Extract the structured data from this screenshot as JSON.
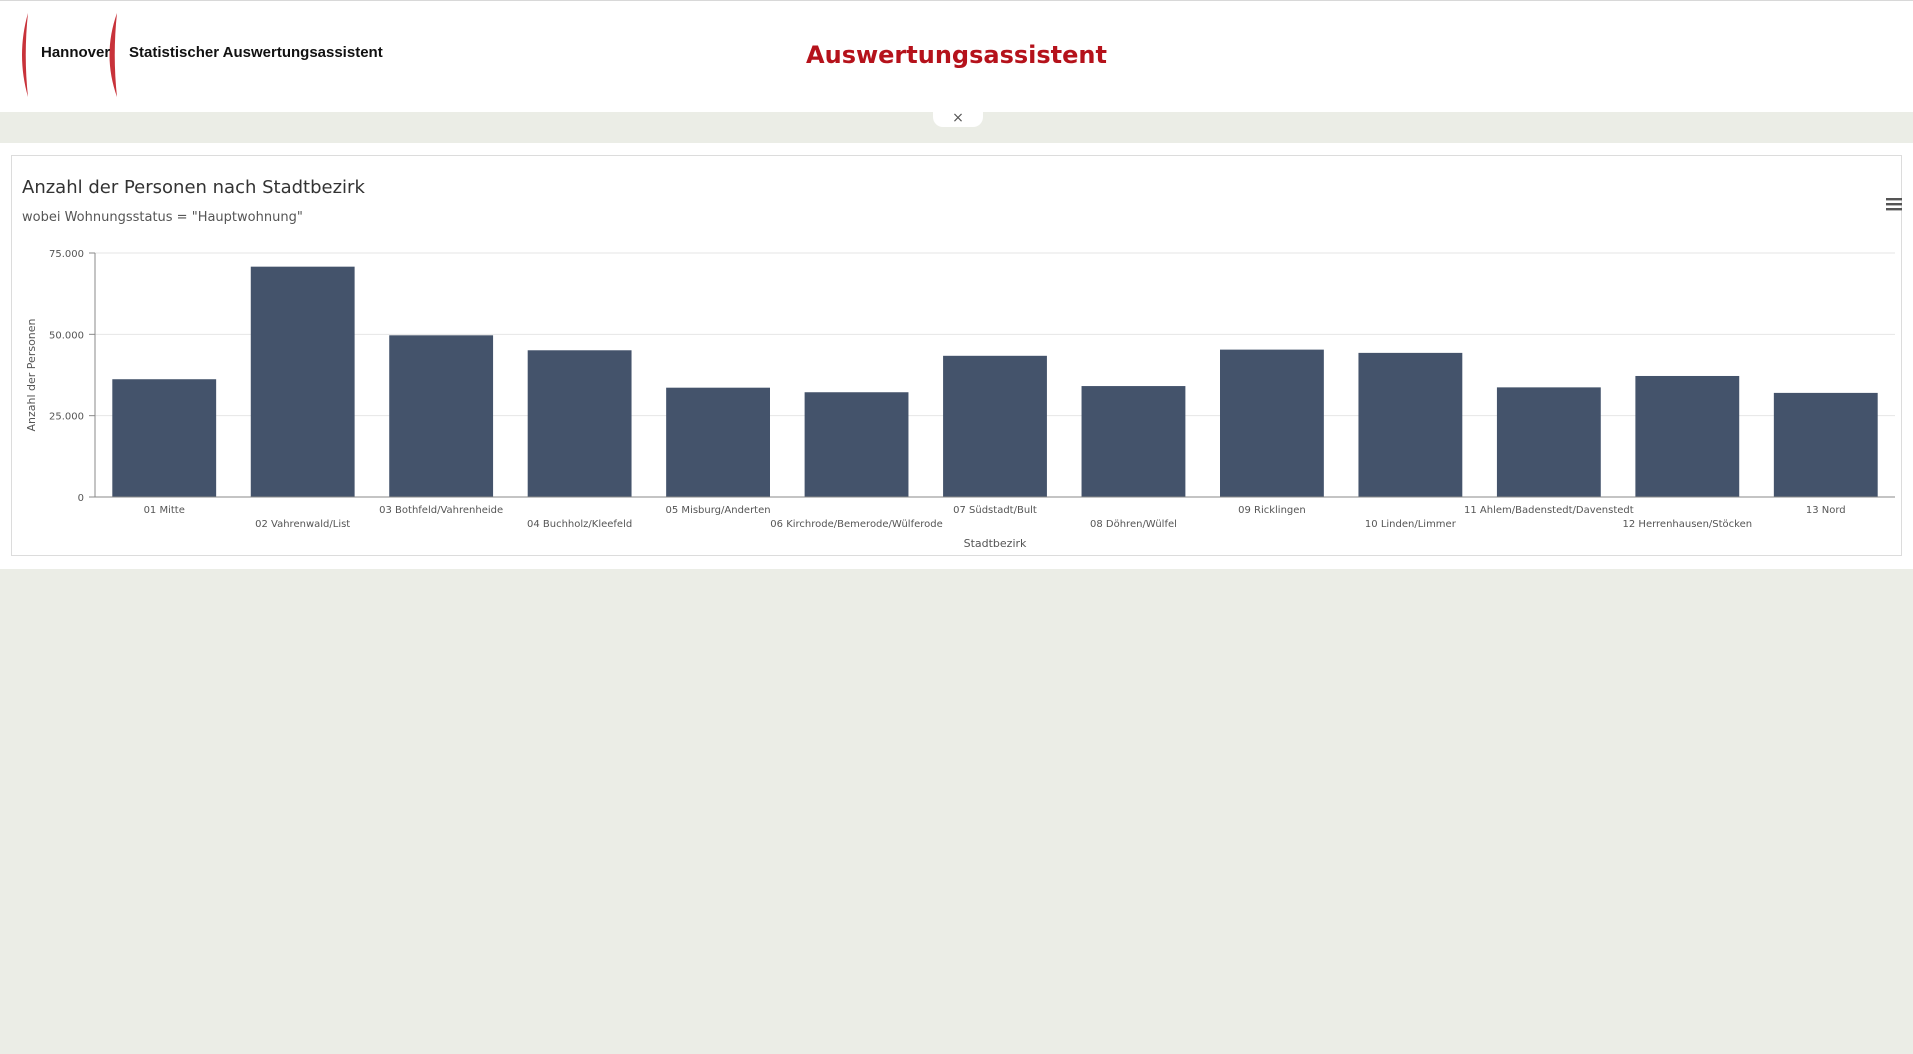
{
  "header": {
    "logo_city": "Hannover",
    "logo_app": "Statistischer Auswertungsassistent",
    "title": "Auswertungsassistent",
    "close_glyph": "×"
  },
  "colors": {
    "accent": "#b5121b",
    "bar": "#44536b",
    "background": "#ebede6"
  },
  "icons": {
    "menu": "hamburger-menu-icon",
    "close": "close-icon"
  },
  "chart_data": {
    "type": "bar",
    "title": "Anzahl der Personen nach Stadtbezirk",
    "subtitle": "wobei Wohnungsstatus = \"Hauptwohnung\"",
    "xlabel": "Stadtbezirk",
    "ylabel": "Anzahl der Personen",
    "ylim": [
      0,
      75000
    ],
    "yticks": [
      0,
      25000,
      50000,
      75000
    ],
    "ytick_labels": [
      "0",
      "25.000",
      "50.000",
      "75.000"
    ],
    "grid": true,
    "legend": "none",
    "categories": [
      "01 Mitte",
      "02 Vahrenwald/List",
      "03 Bothfeld/Vahrenheide",
      "04 Buchholz/Kleefeld",
      "05 Misburg/Anderten",
      "06 Kirchrode/Bemerode/Wülferode",
      "07 Südstadt/Bult",
      "08 Döhren/Wülfel",
      "09 Ricklingen",
      "10 Linden/Limmer",
      "11 Ahlem/Badenstedt/Davenstedt",
      "12 Herrenhausen/Stöcken",
      "13 Nord"
    ],
    "values": [
      36200,
      70800,
      49700,
      45100,
      33600,
      32200,
      43400,
      34100,
      45300,
      44300,
      33700,
      37200,
      32000
    ]
  }
}
